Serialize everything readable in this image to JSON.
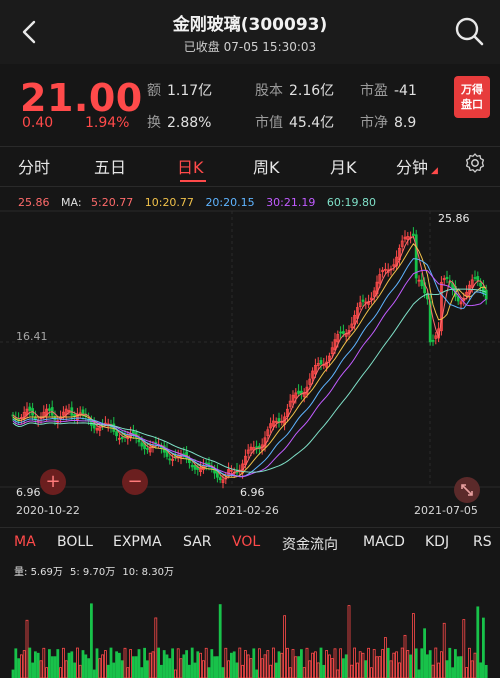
{
  "header": {
    "title": "金刚玻璃(300093)",
    "subtitle": "已收盘 07-05 15:30:03"
  },
  "quote": {
    "price": "21.00",
    "change": "0.40",
    "change_pct": "1.94%",
    "stats": [
      {
        "label": "额",
        "value": "1.17亿"
      },
      {
        "label": "换",
        "value": "2.88%"
      },
      {
        "label": "股本",
        "value": "2.16亿"
      },
      {
        "label": "市值",
        "value": "45.4亿"
      },
      {
        "label": "市盈",
        "value": "-41"
      },
      {
        "label": "市净",
        "value": "8.9"
      }
    ],
    "badge_line1": "万得",
    "badge_line2": "盘口"
  },
  "tabs": [
    "分时",
    "五日",
    "日K",
    "周K",
    "月K",
    "分钟"
  ],
  "active_tab": "日K",
  "ma_legend": {
    "price": "25.86",
    "label": "MA:",
    "items": [
      {
        "text": "5:20.77",
        "color": "#ff6b6b"
      },
      {
        "text": "10:20.77",
        "color": "#f0c14a"
      },
      {
        "text": "20:20.15",
        "color": "#5fb4ff"
      },
      {
        "text": "30:21.19",
        "color": "#c15cff"
      },
      {
        "text": "60:19.80",
        "color": "#7fe0c8"
      }
    ]
  },
  "axis": {
    "y_top": "25.86",
    "y_mid": "16.41",
    "y_bot": "6.96",
    "x_left": "2020-10-22",
    "x_mid": "2021-02-26",
    "x_right": "2021-07-05",
    "low_label": "6.96",
    "high_label": "25.86"
  },
  "indicators": [
    "MA",
    "BOLL",
    "EXPMA",
    "SAR",
    "VOL",
    "资金流向",
    "MACD",
    "KDJ",
    "RS"
  ],
  "vol_legend": {
    "label": "量:",
    "value": "5.69万",
    "ma5": "5: 9.70万",
    "ma10": "10: 8.30万"
  },
  "colors": {
    "up": "#ff4a4a",
    "down": "#18c24a",
    "bg": "#161616"
  }
}
